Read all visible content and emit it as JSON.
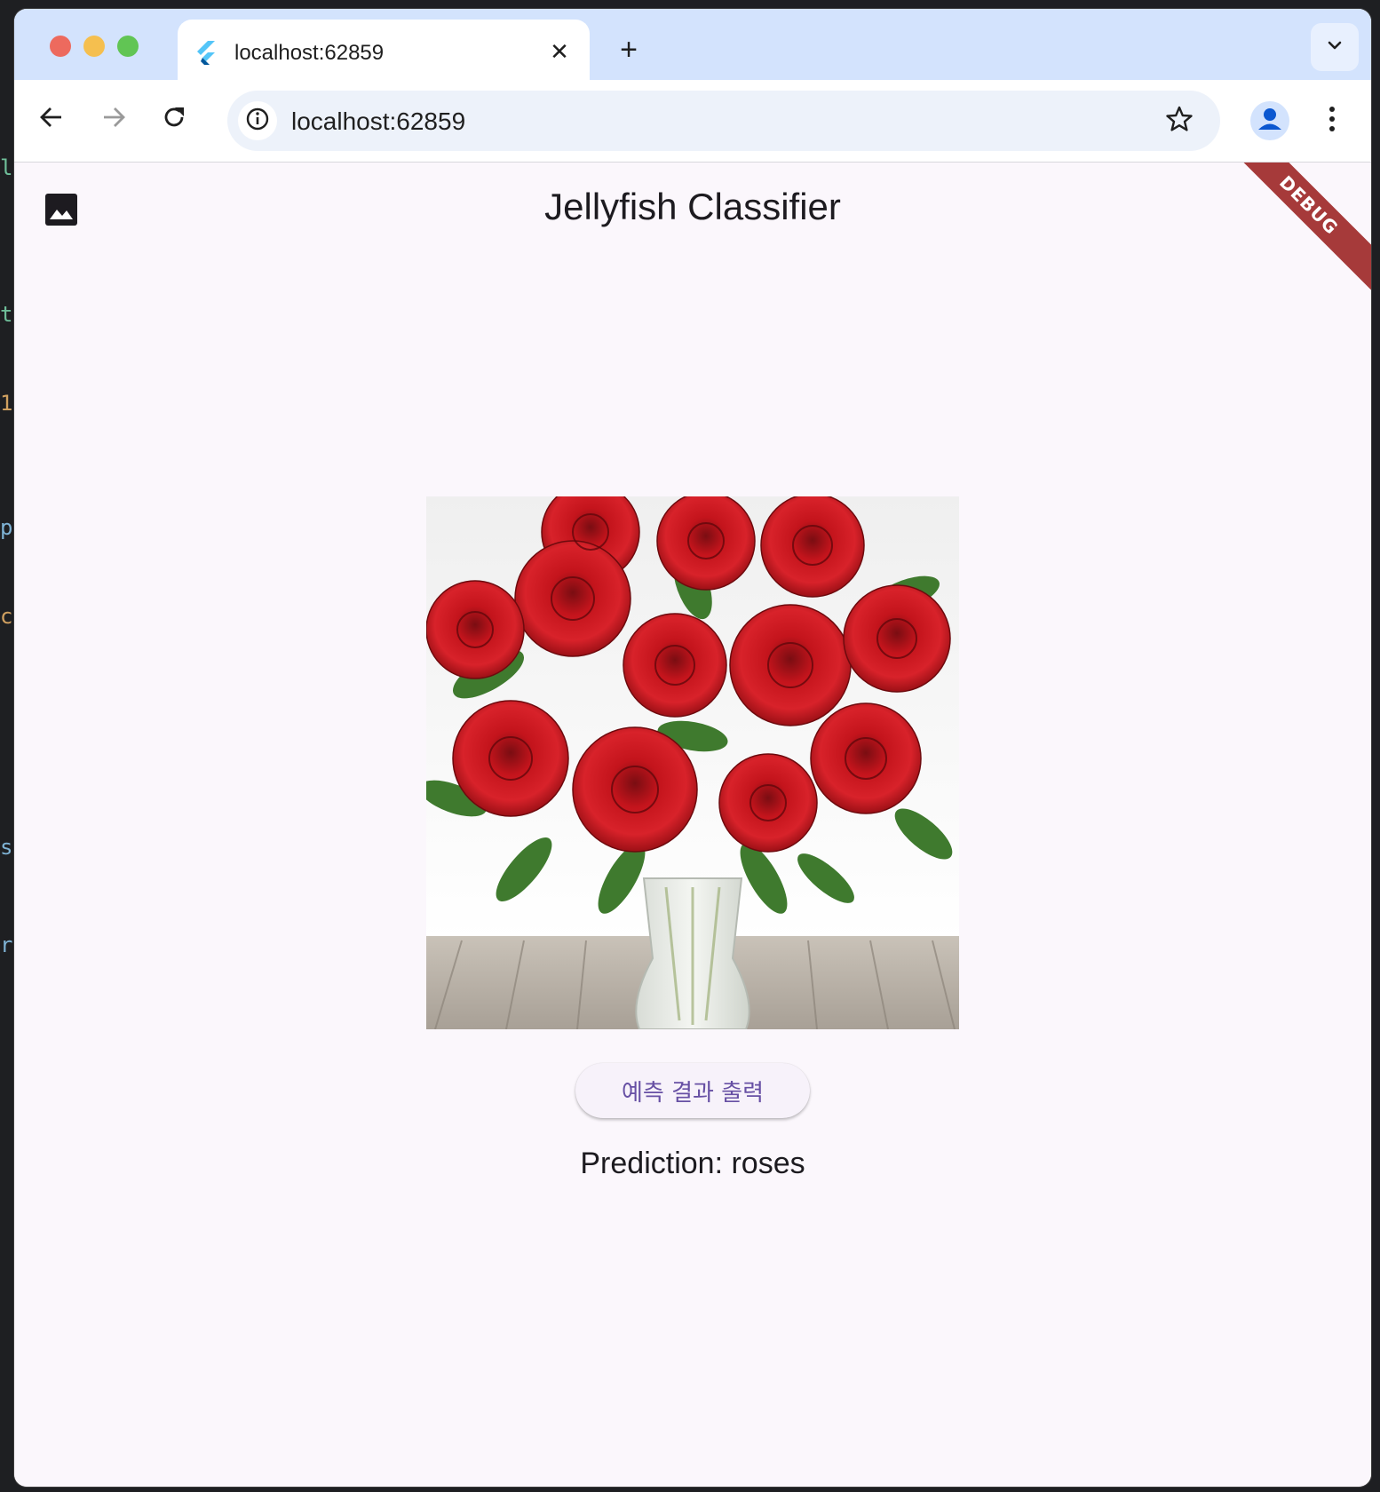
{
  "browser": {
    "tab_title": "localhost:62859",
    "new_tab_symbol": "+",
    "close_tab_symbol": "✕",
    "url": "localhost:62859"
  },
  "app": {
    "title": "Jellyfish Classifier",
    "debug_banner": "DEBUG",
    "predict_button_label": "예측 결과 출력",
    "prediction_text": "Prediction: roses",
    "image_subject": "bouquet of red roses in a glass vase on a wooden table"
  },
  "icons": {
    "back": "arrow-left-icon",
    "forward": "arrow-right-icon",
    "reload": "reload-icon",
    "info": "info-icon",
    "bookmark": "star-icon",
    "profile": "person-icon",
    "menu": "more-vert-icon",
    "gallery": "image-icon",
    "tab_favicon": "flutter-icon",
    "tab_menu": "chevron-down-icon"
  },
  "colors": {
    "accent": "#6750a4",
    "tabstrip": "#d3e3fd",
    "page_background": "#fbf7fc",
    "debug_banner": "#a63a3a"
  }
}
